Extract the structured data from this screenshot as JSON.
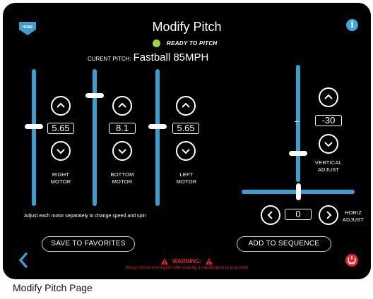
{
  "header": {
    "home_icon": "home-icon",
    "home_label": "HOME",
    "title": "Modify Pitch",
    "status_text": "READY TO PITCH",
    "status_color": "#9fd23c",
    "info_icon": "info-icon",
    "info_glyph": "i"
  },
  "current_pitch": {
    "label": "CURENT PITCH:",
    "value": "Fastball 85MPH"
  },
  "motors": [
    {
      "name": "RIGHT\nMOTOR",
      "value": "5.65",
      "level": 0.58
    },
    {
      "name": "BOTTOM\nMOTOR",
      "value": "8.1",
      "level": 0.81
    },
    {
      "name": "LEFT\nMOTOR",
      "value": "5.65",
      "level": 0.58
    }
  ],
  "hint": "Adjust each motor separately to change speed and spin",
  "vertical_adjust": {
    "label": "VERTICAL\nADJUST",
    "value": "-30"
  },
  "horiz_adjust": {
    "label": "HORIZ\nADJUST",
    "value": "0"
  },
  "buttons": {
    "save_favorites": "SAVE TO FAVORITES",
    "add_sequence": "ADD TO SEQUENCE"
  },
  "warning": {
    "title": "WARNING:",
    "text": "Always throw a test pitch after making a modification to your pitch",
    "color": "#e0242a"
  },
  "stop_label": "STOP",
  "accent_color": "#3a9fd0",
  "caption": "Modify Pitch Page"
}
